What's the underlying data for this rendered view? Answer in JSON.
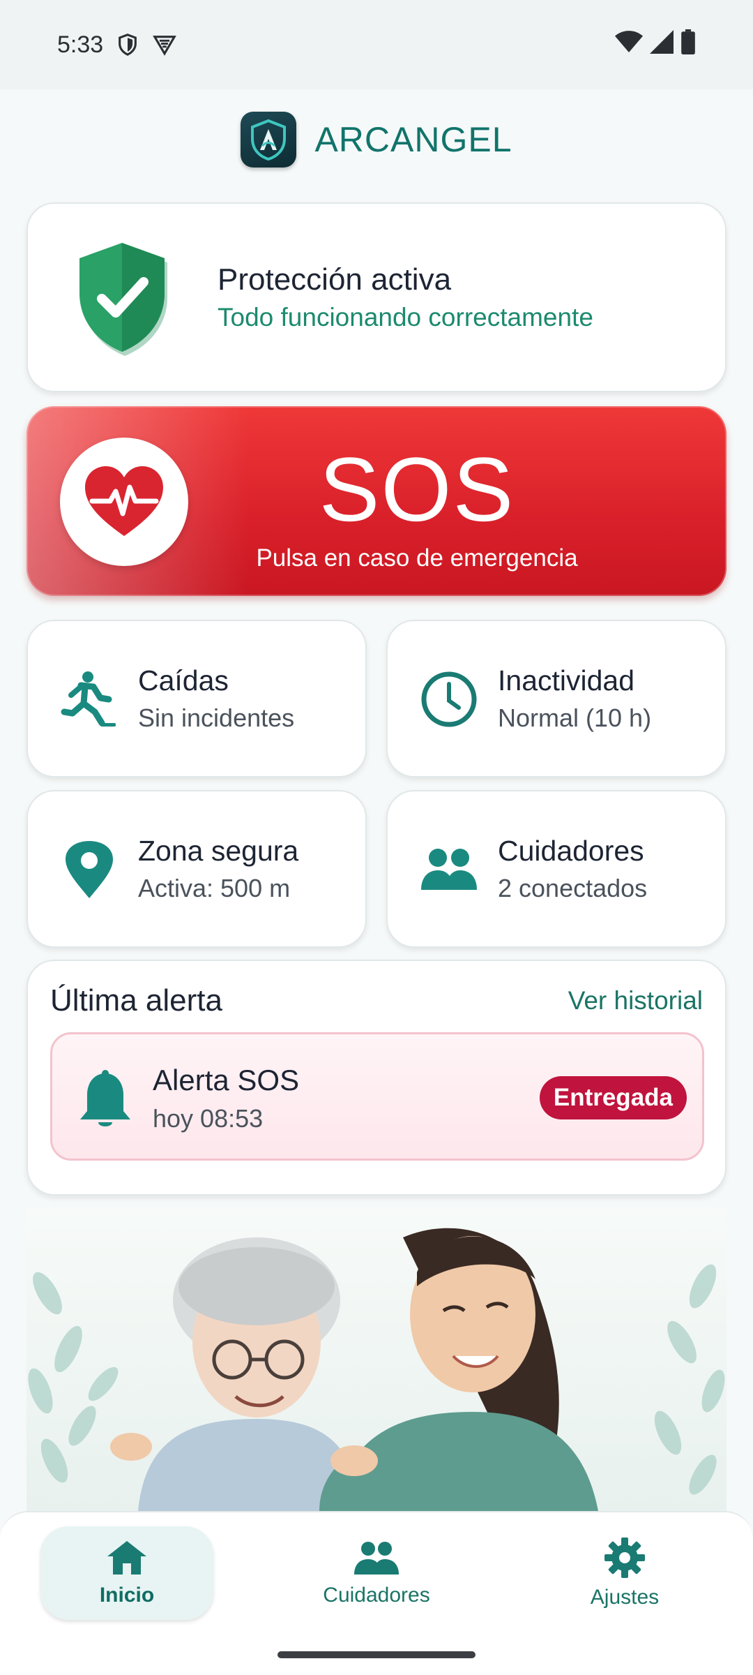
{
  "status_bar": {
    "time": "5:33",
    "icons": [
      "shield-outline-icon",
      "vpn-icon",
      "wifi-icon",
      "signal-icon",
      "battery-icon"
    ]
  },
  "app": {
    "title": "ARCANGEL",
    "logo": "arcangel-shield-logo"
  },
  "protection": {
    "title": "Protección activa",
    "subtitle": "Todo funcionando correctamente",
    "icon": "check-shield-icon"
  },
  "sos": {
    "label": "SOS",
    "subtitle": "Pulsa en caso de emergencia",
    "icon": "heart-pulse-icon"
  },
  "tiles": {
    "falls": {
      "title": "Caídas",
      "subtitle": "Sin incidentes",
      "icon": "falling-person-icon"
    },
    "inactivity": {
      "title": "Inactividad",
      "subtitle": "Normal (10 h)",
      "icon": "clock-icon"
    },
    "safe_zone": {
      "title": "Zona segura",
      "subtitle": "Activa: 500 m",
      "icon": "location-pin-icon"
    },
    "caregivers": {
      "title": "Cuidadores",
      "subtitle": "2 conectados",
      "icon": "people-icon"
    }
  },
  "last_alert": {
    "heading": "Última alerta",
    "history_link": "Ver historial",
    "item": {
      "title": "Alerta SOS",
      "time": "hoy 08:53",
      "badge": "Entregada",
      "icon": "bell-icon"
    }
  },
  "illustration": "elderly-woman-with-caregiver",
  "nav": {
    "home": "Inicio",
    "caregivers": "Cuidadores",
    "settings": "Ajustes"
  },
  "colors": {
    "brand": "#11746c",
    "sos_red": "#d9202a",
    "badge_red": "#c0133d",
    "success_green": "#1c8a6e"
  }
}
